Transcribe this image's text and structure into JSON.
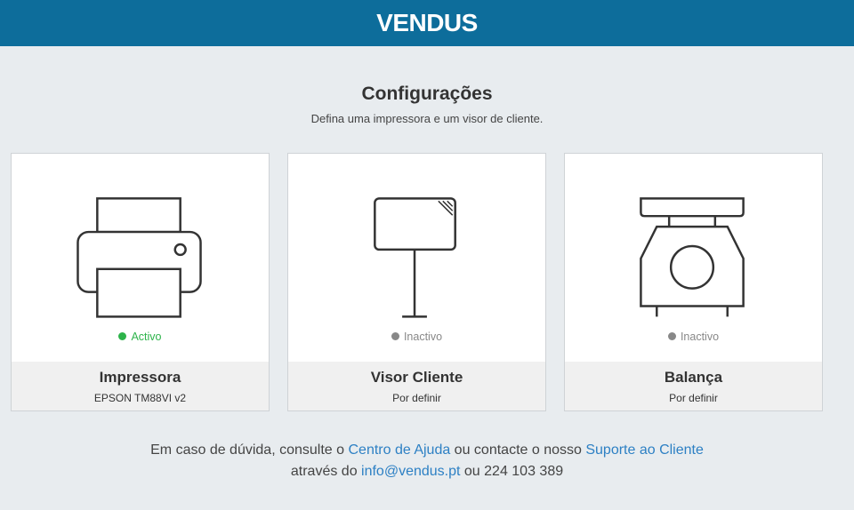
{
  "header": {
    "logo": "VENDUS"
  },
  "page": {
    "title": "Configurações",
    "subtitle": "Defina uma impressora e um visor de cliente."
  },
  "cards": [
    {
      "name": "Impressora",
      "detail": "EPSON TM88VI v2",
      "status": "Activo",
      "icon": "printer-icon",
      "active": true
    },
    {
      "name": "Visor Cliente",
      "detail": "Por definir",
      "status": "Inactivo",
      "icon": "customer-display-icon",
      "active": false
    },
    {
      "name": "Balança",
      "detail": "Por definir",
      "status": "Inactivo",
      "icon": "scale-icon",
      "active": false
    }
  ],
  "footer": {
    "line1_a": "Em caso de dúvida, consulte o ",
    "help_link": "Centro de Ajuda",
    "line1_b": " ou contacte o nosso ",
    "support_link": "Suporte ao Cliente",
    "line2_a": "através do ",
    "email_link": "info@vendus.pt",
    "line2_b": " ou 224 103 389"
  },
  "colors": {
    "topbar": "#0d6d9b",
    "active": "#2db34a",
    "inactive": "#888888",
    "link": "#2d80c4"
  }
}
